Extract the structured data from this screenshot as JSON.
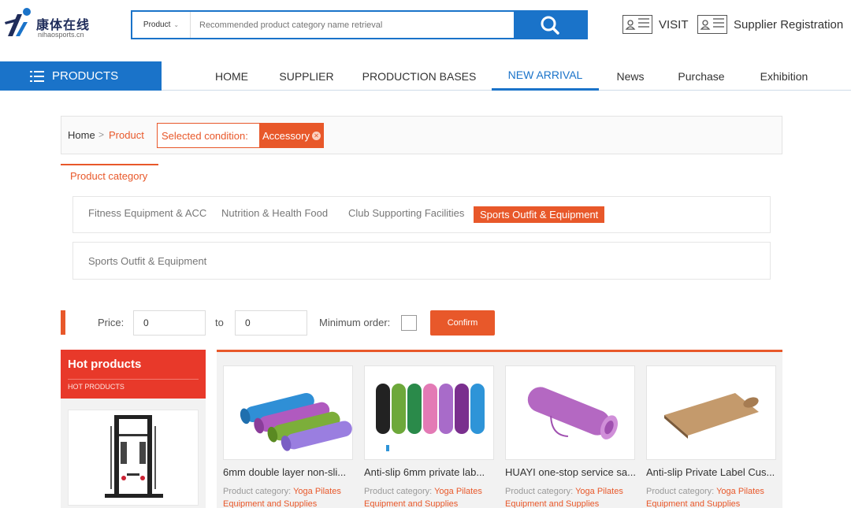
{
  "header": {
    "logo_cn": "康体在线",
    "logo_en": "nihaosports.cn",
    "search": {
      "type": "Product",
      "placeholder": "Recommended product category name retrieval"
    },
    "visit": "VISIT",
    "supplier_registration": "Supplier Registration"
  },
  "nav": {
    "products": "PRODUCTS",
    "items": [
      "HOME",
      "SUPPLIER",
      "PRODUCTION BASES",
      "NEW ARRIVAL",
      "News",
      "Purchase",
      "Exhibition"
    ],
    "active": "NEW ARRIVAL"
  },
  "breadcrumb": {
    "home": "Home",
    "separator": ">",
    "product": "Product",
    "condition_label": "Selected condition:",
    "condition_tag": "Accessory"
  },
  "category": {
    "title": "Product category",
    "items": [
      "Fitness Equipment & ACC",
      "Nutrition & Health Food",
      "Club Supporting Facilities",
      "Sports Outfit & Equipment"
    ],
    "active": "Sports Outfit & Equipment",
    "sub_items": [
      "Sports Outfit & Equipment"
    ]
  },
  "filter": {
    "price_label": "Price:",
    "price_min": "0",
    "to_label": "to",
    "price_max": "0",
    "min_order_label": "Minimum order:",
    "confirm": "Confirm"
  },
  "hot": {
    "title": "Hot products",
    "subtitle": "HOT PRODUCTS"
  },
  "products": [
    {
      "title": "6mm double layer non-sli...",
      "cat_label": "Product category:",
      "cat_value_1": "Yoga Pilates",
      "cat_value_2": "Equipment and Supplies"
    },
    {
      "title": "Anti-slip 6mm private lab...",
      "cat_label": "Product category:",
      "cat_value_1": "Yoga Pilates",
      "cat_value_2": "Equipment and Supplies"
    },
    {
      "title": "HUAYI one-stop service sa...",
      "cat_label": "Product category:",
      "cat_value_1": "Yoga Pilates",
      "cat_value_2": "Equipment and Supplies"
    },
    {
      "title": "Anti-slip Private Label Cus...",
      "cat_label": "Product category:",
      "cat_value_1": "Yoga Pilates",
      "cat_value_2": "Equipment and Supplies"
    }
  ],
  "colors": {
    "brand_blue": "#1a73c9",
    "accent_orange": "#e8582a",
    "hot_red": "#e8392a"
  }
}
